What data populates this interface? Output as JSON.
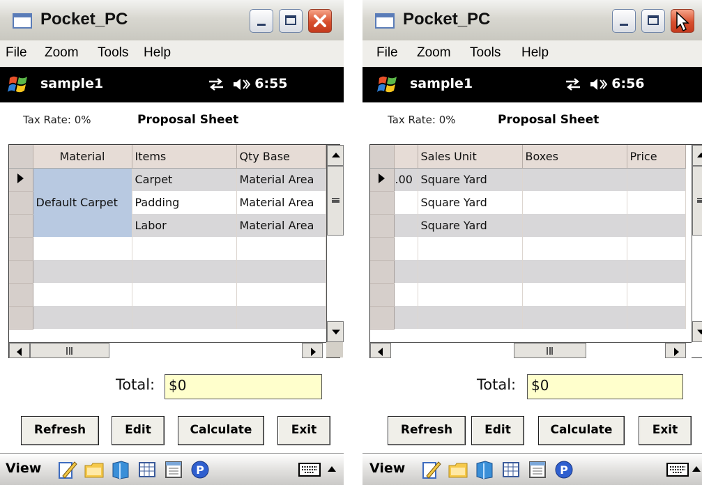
{
  "menu": [
    "File",
    "Zoom",
    "Tools",
    "Help"
  ],
  "screens": [
    {
      "window_title": "Pocket_PC",
      "device_name": "sample1",
      "clock": "6:55",
      "tax_rate_label": "Tax Rate: 0%",
      "sheet_title": "Proposal Sheet",
      "columns": [
        "Material",
        "Items",
        "Qty Base"
      ],
      "rows": [
        {
          "material": "",
          "items": "Carpet",
          "qty_base": "Material Area"
        },
        {
          "material": "Default Carpet",
          "items": "Padding",
          "qty_base": "Material Area"
        },
        {
          "material": "",
          "items": "Labor",
          "qty_base": "Material Area"
        }
      ],
      "total_label": "Total:",
      "total_value": "$0",
      "buttons": {
        "refresh": "Refresh",
        "edit": "Edit",
        "calculate": "Calculate",
        "exit": "Exit"
      },
      "bottom_bar_label": "View"
    },
    {
      "window_title": "Pocket_PC",
      "device_name": "sample1",
      "clock": "6:56",
      "tax_rate_label": "Tax Rate: 0%",
      "sheet_title": "Proposal Sheet",
      "columns": [
        "",
        "Sales Unit",
        "Boxes",
        "Price"
      ],
      "rows": [
        {
          "partial": ".00",
          "sales_unit": "Square Yard",
          "boxes": "",
          "price": ""
        },
        {
          "partial": "",
          "sales_unit": "Square Yard",
          "boxes": "",
          "price": ""
        },
        {
          "partial": "",
          "sales_unit": "Square Yard",
          "boxes": "",
          "price": ""
        }
      ],
      "total_label": "Total:",
      "total_value": "$0",
      "buttons": {
        "refresh": "Refresh",
        "edit": "Edit",
        "calculate": "Calculate",
        "exit": "Exit"
      },
      "bottom_bar_label": "View"
    }
  ],
  "icons": [
    "window-icon",
    "minimize-icon",
    "maximize-icon",
    "close-icon",
    "windows-start-icon",
    "sync-icon",
    "volume-icon",
    "notes-icon",
    "folder-icon",
    "book-icon",
    "table-icon",
    "calendar-icon",
    "p-icon",
    "keyboard-icon",
    "up-arrow-icon"
  ]
}
